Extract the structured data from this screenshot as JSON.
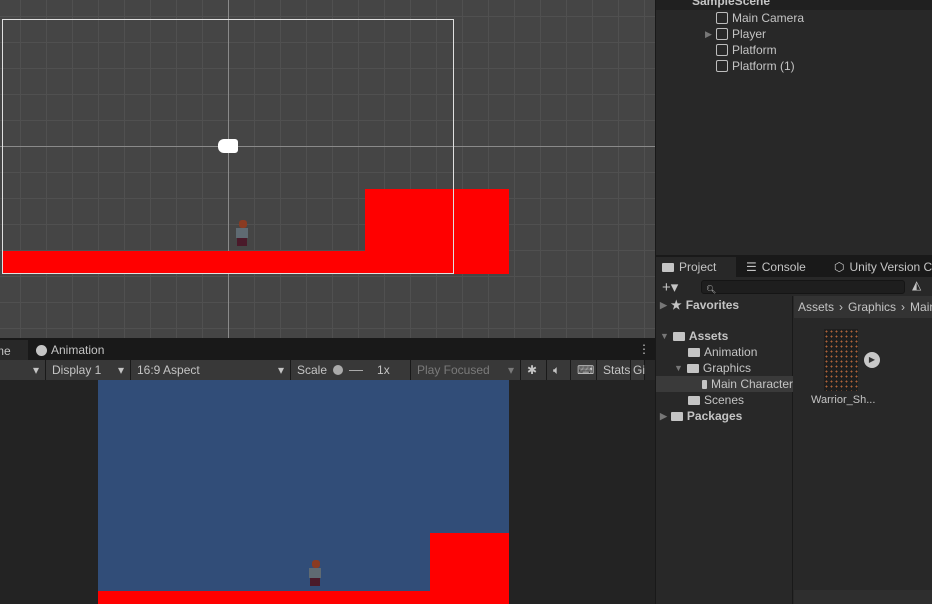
{
  "hierarchy": {
    "scene": "SampleScene",
    "items": [
      "Main Camera",
      "Player",
      "Platform",
      "Platform (1)"
    ]
  },
  "game_view": {
    "tabs": [
      "Game",
      "Animation"
    ],
    "display": "Display 1",
    "aspect": "16:9 Aspect",
    "scale_label": "Scale",
    "scale_value": "1x",
    "play_mode": "Play Focused",
    "stats": "Stats",
    "gizmos": "Gi"
  },
  "project": {
    "tabs": [
      "Project",
      "Console",
      "Unity Version Control"
    ],
    "search_placeholder": "",
    "tree": {
      "favorites": "Favorites",
      "assets": "Assets",
      "animation": "Animation",
      "graphics": "Graphics",
      "main_character": "Main Character",
      "scenes": "Scenes",
      "packages": "Packages"
    },
    "breadcrumb": [
      "Assets",
      "Graphics",
      "Main Character"
    ],
    "asset": "Warrior_Sh..."
  },
  "colors": {
    "platform": "#ff0000",
    "game_bg": "#314d78",
    "scene_bg": "#454545"
  }
}
